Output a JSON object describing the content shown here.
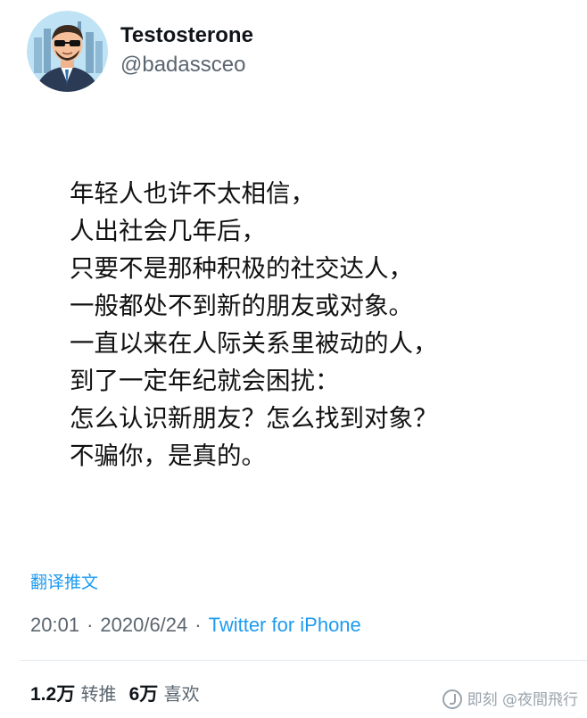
{
  "user": {
    "name": "Testosterone",
    "handle": "@badassceo",
    "avatar_icon": "avatar-illustration-suit-sunglasses"
  },
  "tweet": {
    "lines": [
      "年轻人也许不太相信，",
      "人出社会几年后，",
      "只要不是那种积极的社交达人，",
      "一般都处不到新的朋友或对象。",
      "一直以来在人际关系里被动的人，",
      "到了一定年纪就会困扰：",
      "怎么认识新朋友？怎么找到对象？",
      "不骗你，是真的。"
    ],
    "translate_label": "翻译推文"
  },
  "meta": {
    "time": "20:01",
    "date": "2020/6/24",
    "separator": "·",
    "source": "Twitter for iPhone"
  },
  "stats": {
    "retweets_count": "1.2万",
    "retweets_label": "转推",
    "likes_count": "6万",
    "likes_label": "喜欢"
  },
  "watermark": {
    "text": "即刻 @夜間飛行"
  },
  "colors": {
    "accent": "#1d9bf0",
    "secondary_text": "#5b6670",
    "primary_text": "#0f1419"
  }
}
